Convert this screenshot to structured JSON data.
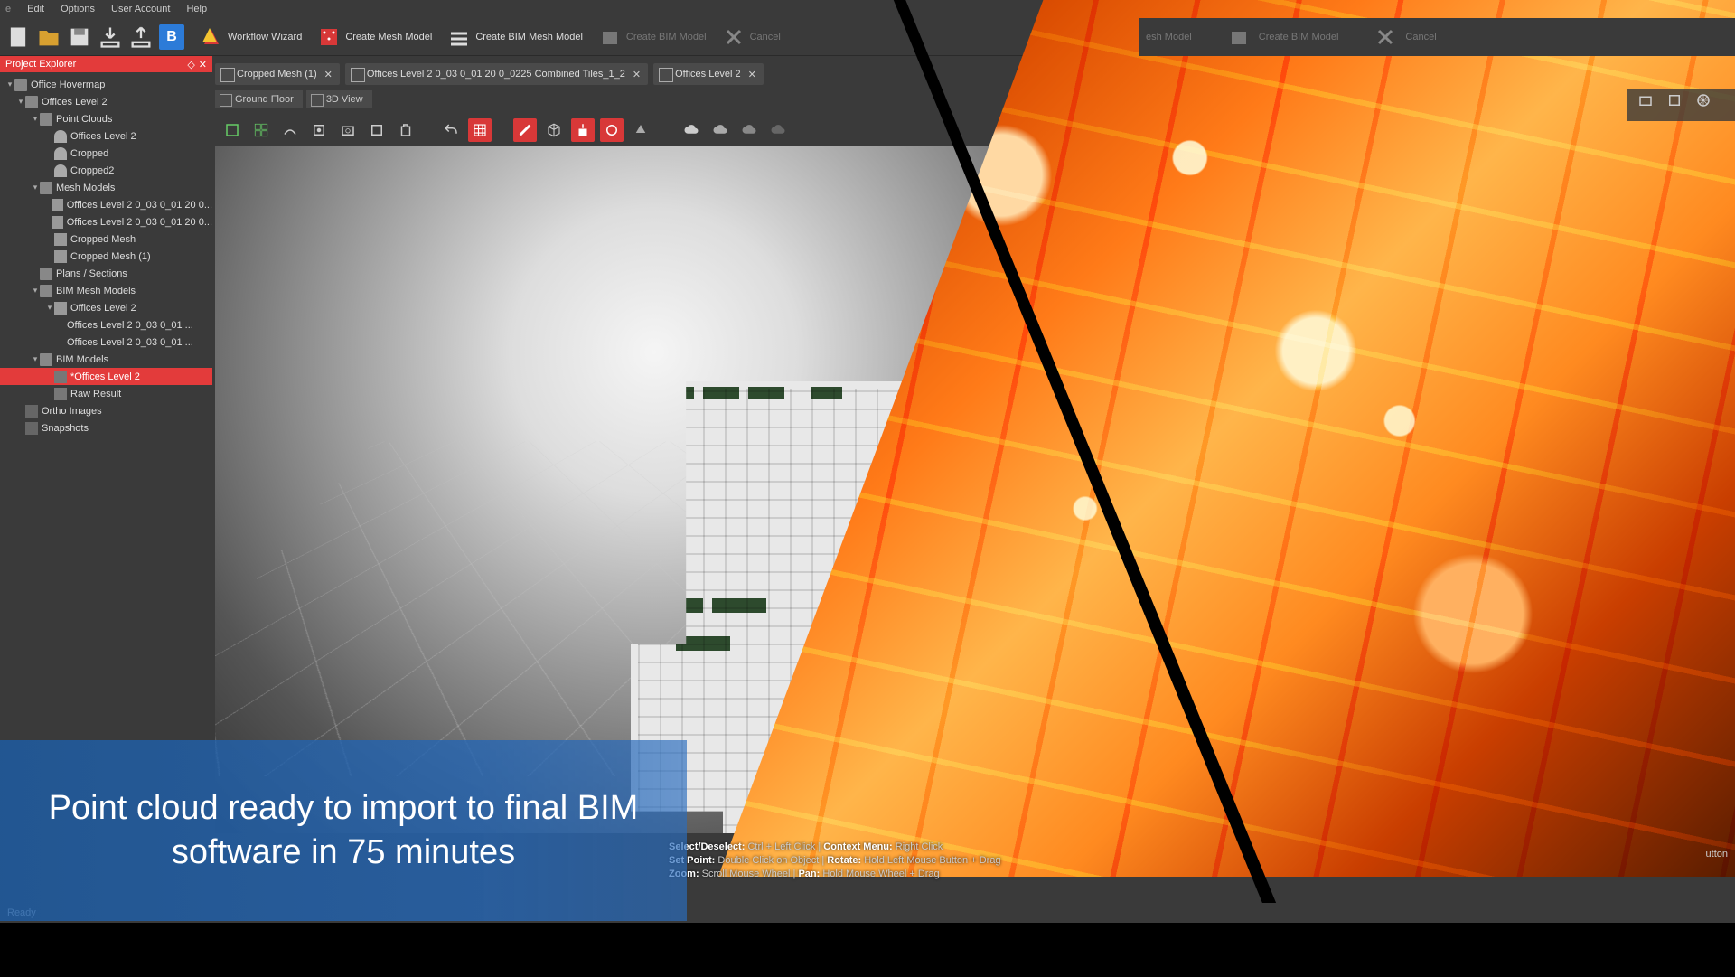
{
  "menu": {
    "items": [
      "File",
      "Edit",
      "Options",
      "User Account",
      "Help"
    ]
  },
  "toolbar": {
    "workflow_wizard": "Workflow Wizard",
    "create_mesh": "Create Mesh Model",
    "create_bim_mesh": "Create BIM Mesh Model",
    "create_bim_model": "Create BIM Model",
    "cancel": "Cancel",
    "right_mesh_model": "esh Model",
    "right_create_bim": "Create BIM Model",
    "right_cancel": "Cancel"
  },
  "explorer": {
    "title": "Project Explorer",
    "root": "Office Hovermap",
    "items": [
      {
        "l": 1,
        "t": "Offices Level 2",
        "i": "folder",
        "a": "▾"
      },
      {
        "l": 2,
        "t": "Point Clouds",
        "i": "folder",
        "a": "▾"
      },
      {
        "l": 3,
        "t": "Offices Level 2",
        "i": "cloud",
        "a": ""
      },
      {
        "l": 3,
        "t": "Cropped",
        "i": "cloud",
        "a": ""
      },
      {
        "l": 3,
        "t": "Cropped2",
        "i": "cloud",
        "a": ""
      },
      {
        "l": 2,
        "t": "Mesh Models",
        "i": "folder",
        "a": "▾"
      },
      {
        "l": 3,
        "t": "Offices Level 2 0_03 0_01 20 0...",
        "i": "mesh",
        "a": ""
      },
      {
        "l": 3,
        "t": "Offices Level 2 0_03 0_01 20 0...",
        "i": "mesh",
        "a": ""
      },
      {
        "l": 3,
        "t": "Cropped Mesh",
        "i": "mesh",
        "a": ""
      },
      {
        "l": 3,
        "t": "Cropped Mesh (1)",
        "i": "mesh",
        "a": ""
      },
      {
        "l": 2,
        "t": "Plans / Sections",
        "i": "folder",
        "a": ""
      },
      {
        "l": 2,
        "t": "BIM Mesh Models",
        "i": "folder",
        "a": "▾"
      },
      {
        "l": 3,
        "t": "Offices Level 2",
        "i": "mesh",
        "a": "▾"
      },
      {
        "l": 3,
        "t": "  Offices Level 2 0_03 0_01 ...",
        "i": "",
        "a": ""
      },
      {
        "l": 3,
        "t": "  Offices Level 2 0_03 0_01 ...",
        "i": "",
        "a": ""
      },
      {
        "l": 2,
        "t": "BIM Models",
        "i": "folder",
        "a": "▾"
      },
      {
        "l": 3,
        "t": "*Offices Level 2",
        "i": "bim",
        "a": "",
        "sel": true
      },
      {
        "l": 3,
        "t": "Raw Result",
        "i": "bim",
        "a": ""
      },
      {
        "l": 1,
        "t": "Ortho Images",
        "i": "ortho",
        "a": ""
      },
      {
        "l": 1,
        "t": "Snapshots",
        "i": "ortho",
        "a": ""
      }
    ]
  },
  "tabs": [
    {
      "label": "Cropped Mesh (1)"
    },
    {
      "label": "Offices Level 2 0_03 0_01 20 0_0225 Combined Tiles_1_2"
    },
    {
      "label": "Offices Level 2"
    }
  ],
  "viewtabs": {
    "ground": "Ground Floor",
    "view3d": "3D View"
  },
  "hints": {
    "l1a": "Select/Deselect:",
    "l1b": " Ctrl + Left Click  |  ",
    "l1c": "Context Menu:",
    "l1d": " Right Click",
    "l2a": "Set Point:",
    "l2b": " Double Click on Object  |  ",
    "l2c": "Rotate:",
    "l2d": " Hold Left Mouse Button + Drag",
    "l3a": "Zoom:",
    "l3b": " Scroll Mouse Wheel  |  ",
    "l3c": "Pan:",
    "l3d": " Hold Mouse Wheel + Drag"
  },
  "status": {
    "ready": "Ready"
  },
  "righthint": "utton",
  "caption": "Point cloud ready to import to final BIM software in 75 minutes",
  "colors": {
    "accent": "#e33b3b",
    "caption_bg": "#2566b4"
  }
}
